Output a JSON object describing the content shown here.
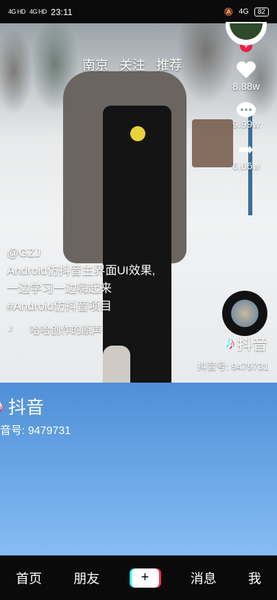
{
  "status_bar": {
    "signal_1": "4G HD",
    "signal_2": "4G HD",
    "time": "23:11",
    "net": "4G",
    "battery": "82"
  },
  "top_tabs": [
    "南京",
    "关注",
    "推荐"
  ],
  "actions": {
    "likes": "8.88w",
    "comments": "9.99w",
    "shares": "6.66w"
  },
  "caption": {
    "author": "@GZJ",
    "lines": [
      "Android仿抖音主界面UI效果,",
      "一边学习一边嗨起来",
      "#Android仿抖音项目"
    ]
  },
  "music": {
    "note": "♪",
    "text": "哈哈创作的原声"
  },
  "brand": {
    "name": "抖音",
    "id": "抖音号: 9479731"
  },
  "brand_partial": {
    "name": "抖音",
    "id": "音号: 9479731"
  },
  "bottom_nav": {
    "home": "首页",
    "friends": "朋友",
    "plus": "+",
    "messages": "消息",
    "me": "我"
  }
}
